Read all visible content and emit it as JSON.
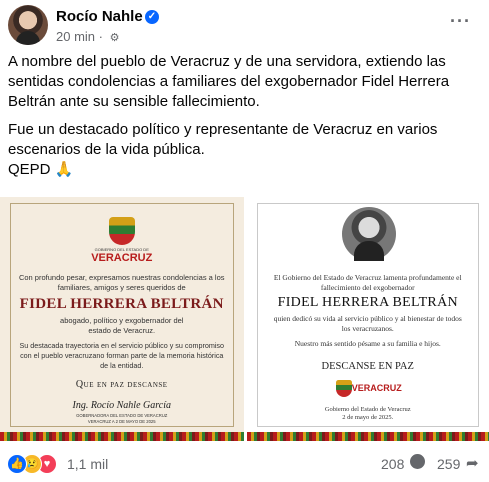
{
  "post": {
    "author": "Rocío Nahle",
    "verified_icon": "verified-badge-icon",
    "time": "20 min",
    "separator": "·",
    "audience_icon": "gear-icon",
    "more_icon": "more-options-icon",
    "paragraph1": "A nombre del pueblo de Veracruz y de una servidora, extiendo las sentidas condolencias a familiares del exgobernador Fidel Herrera Beltrán ante su sensible fallecimiento.",
    "paragraph2_line1": "Fue un destacado político y representante de Veracruz en varios escenarios de la vida pública.",
    "paragraph2_line2": "QEPD 🙏"
  },
  "image1": {
    "gov_label": "GOBIERNO DEL ESTADO DE",
    "state": "VERACRUZ",
    "intro": "Con profundo pesar, expresamos nuestras condolencias a los familiares, amigos y seres queridos de",
    "name": "FIDEL HERRERA BELTRÁN",
    "role": "abogado, político y exgobernador del estado de Veracruz.",
    "tribute": "Su destacada trayectoria en el servicio público y su compromiso con el pueblo veracruzano forman parte de la memoria histórica de la entidad.",
    "rip": "Que en paz descanse",
    "signature": "Ing. Rocío Nahle García",
    "sign_title": "GOBERNADORA DEL ESTADO DE VERACRUZ",
    "sign_date": "VERACRUZ A 2 DE MAYO DE 2025"
  },
  "image2": {
    "intro": "El Gobierno del Estado de Veracruz lamenta profundamente el fallecimiento del exgobernador",
    "name": "FIDEL HERRERA BELTRÁN",
    "tribute": "quien dedicó su vida al servicio público y al bienestar de todos los veracruzanos.",
    "condolence": "Nuestro más sentido pésame a su familia e hijos.",
    "rip": "DESCANSE EN PAZ",
    "gov_label": "GOBIERNO DEL ESTADO DE",
    "state": "VERACRUZ",
    "sign": "Gobierno del Estado de Veracruz",
    "date": "2 de mayo de 2025."
  },
  "footer": {
    "reaction_icons": [
      "like-icon",
      "sad-icon",
      "love-icon"
    ],
    "reactions": "1,1 mil",
    "comments": "208",
    "comment_icon": "comment-icon",
    "shares": "259",
    "share_icon": "share-icon"
  }
}
